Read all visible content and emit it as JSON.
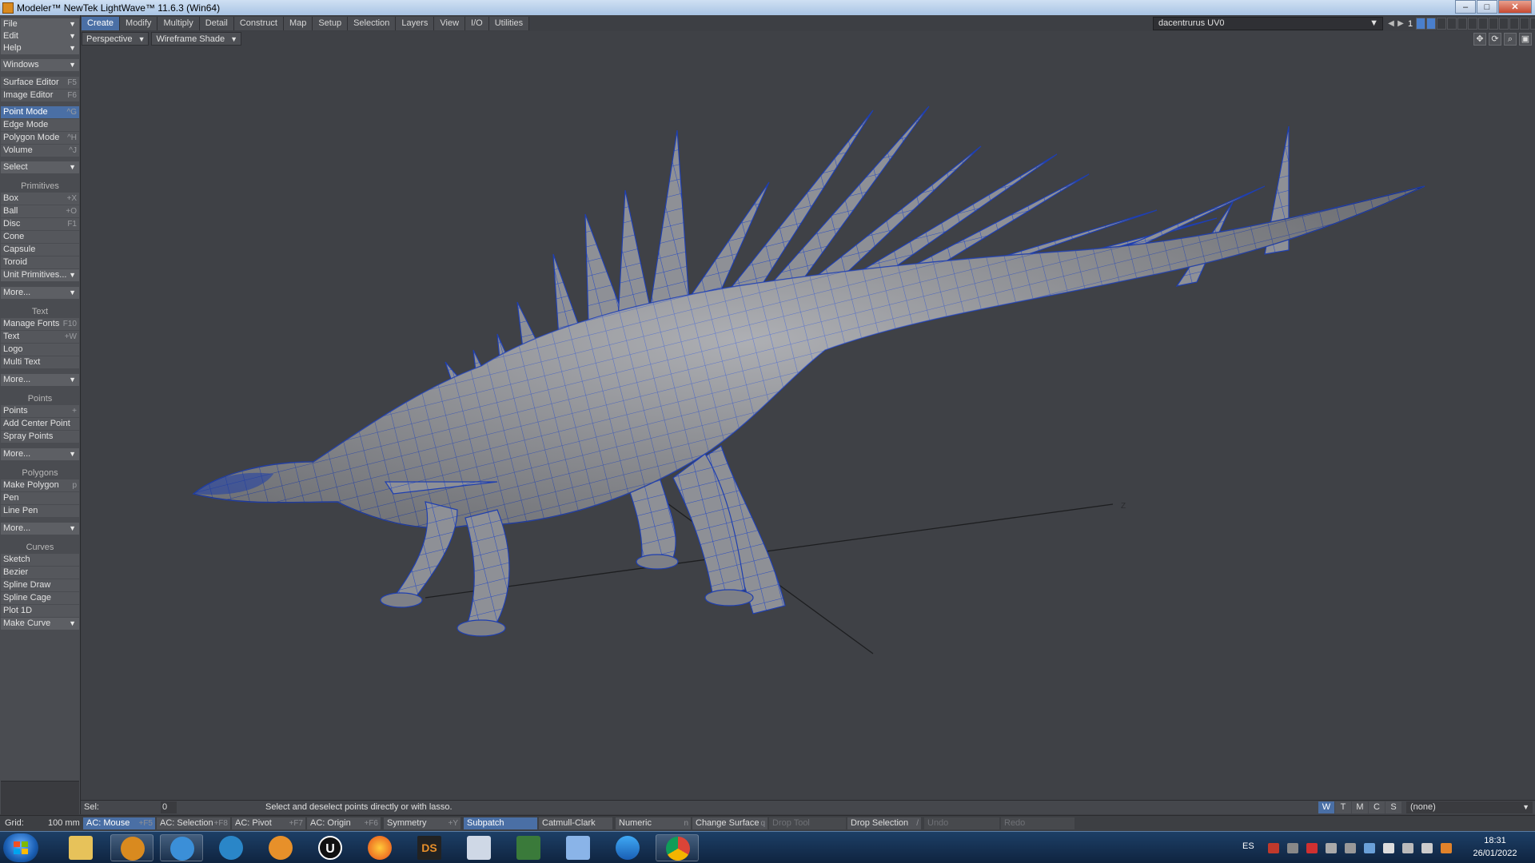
{
  "window": {
    "title": "Modeler™ NewTek LightWave™ 11.6.3 (Win64)",
    "buttons": {
      "minimize": "–",
      "maximize": "□",
      "close": "✕"
    }
  },
  "menu_tabs": [
    "Create",
    "Modify",
    "Multiply",
    "Detail",
    "Construct",
    "Map",
    "Setup",
    "Selection",
    "Layers",
    "View",
    "I/O",
    "Utilities"
  ],
  "active_tab": "Create",
  "top_right": {
    "object_name": "dacentrurus UV0",
    "layer_number": "1"
  },
  "left_panel": {
    "file": "File",
    "edit": "Edit",
    "help": "Help",
    "windows": "Windows",
    "surface_editor": {
      "label": "Surface Editor",
      "key": "F5"
    },
    "image_editor": {
      "label": "Image Editor",
      "key": "F6"
    },
    "point_mode": {
      "label": "Point Mode",
      "key": "^G"
    },
    "edge_mode": {
      "label": "Edge Mode",
      "key": ""
    },
    "polygon_mode": {
      "label": "Polygon Mode",
      "key": "^H"
    },
    "volume": {
      "label": "Volume",
      "key": "^J"
    },
    "select": "Select",
    "primitives_header": "Primitives",
    "primitives": [
      {
        "label": "Box",
        "key": "+X"
      },
      {
        "label": "Ball",
        "key": "+O"
      },
      {
        "label": "Disc",
        "key": "F1"
      },
      {
        "label": "Cone",
        "key": ""
      },
      {
        "label": "Capsule",
        "key": ""
      },
      {
        "label": "Toroid",
        "key": ""
      }
    ],
    "unit_primitives": "Unit Primitives...",
    "more1": "More...",
    "text_header": "Text",
    "text_items": [
      {
        "label": "Manage Fonts",
        "key": "F10"
      },
      {
        "label": "Text",
        "key": "+W"
      },
      {
        "label": "Logo",
        "key": ""
      },
      {
        "label": "Multi Text",
        "key": ""
      }
    ],
    "more2": "More...",
    "points_header": "Points",
    "points_items": [
      {
        "label": "Points",
        "key": "+"
      },
      {
        "label": "Add Center Point",
        "key": ""
      },
      {
        "label": "Spray Points",
        "key": ""
      }
    ],
    "more3": "More...",
    "polygons_header": "Polygons",
    "polygons_items": [
      {
        "label": "Make Polygon",
        "key": "p"
      },
      {
        "label": "Pen",
        "key": ""
      },
      {
        "label": "Line Pen",
        "key": ""
      }
    ],
    "more4": "More...",
    "curves_header": "Curves",
    "curves_items": [
      {
        "label": "Sketch",
        "key": ""
      },
      {
        "label": "Bezier",
        "key": ""
      },
      {
        "label": "Spline Draw",
        "key": ""
      },
      {
        "label": "Spline Cage",
        "key": ""
      },
      {
        "label": "Plot 1D",
        "key": ""
      }
    ],
    "make_curve": "Make Curve"
  },
  "viewport": {
    "view_type": "Perspective",
    "shading": "Wireframe Shade",
    "axis_label": "Z"
  },
  "status": {
    "sel_label": "Sel:",
    "sel_count": "0",
    "hint": "Select and deselect points directly or with lasso.",
    "modes": [
      "W",
      "T",
      "M",
      "C",
      "S"
    ],
    "active_mode": "W",
    "surface": "(none)"
  },
  "bottom_bar": {
    "grid_label": "Grid:",
    "grid_value": "100 mm",
    "ac_mouse": {
      "label": "AC: Mouse",
      "key": "+F5"
    },
    "ac_selection": {
      "label": "AC: Selection",
      "key": "+F8"
    },
    "ac_pivot": {
      "label": "AC: Pivot",
      "key": "+F7"
    },
    "ac_origin": {
      "label": "AC: Origin",
      "key": "+F6"
    },
    "symmetry": {
      "label": "Symmetry",
      "key": "+Y"
    },
    "subpatch": "Subpatch",
    "catmull": "Catmull-Clark",
    "numeric": {
      "label": "Numeric",
      "key": "n"
    },
    "change_surface": {
      "label": "Change Surface",
      "key": "q"
    },
    "drop_tool": "Drop Tool",
    "drop_selection": {
      "label": "Drop Selection",
      "key": "/"
    },
    "undo": "Undo",
    "redo": "Redo"
  },
  "taskbar": {
    "apps": [
      "explorer-icon",
      "lightwave-modeler-icon",
      "lightwave-layout-icon",
      "blender-like-icon",
      "houdini-like-icon",
      "unreal-icon",
      "firefox-icon",
      "daz-studio-icon",
      "window-app-icon",
      "monitor-app-icon",
      "network-app-icon",
      "zbrush-like-icon",
      "chrome-icon"
    ],
    "daz_label": "DS",
    "unreal_label": "U",
    "language": "ES",
    "time": "18:31",
    "date": "26/01/2022"
  }
}
